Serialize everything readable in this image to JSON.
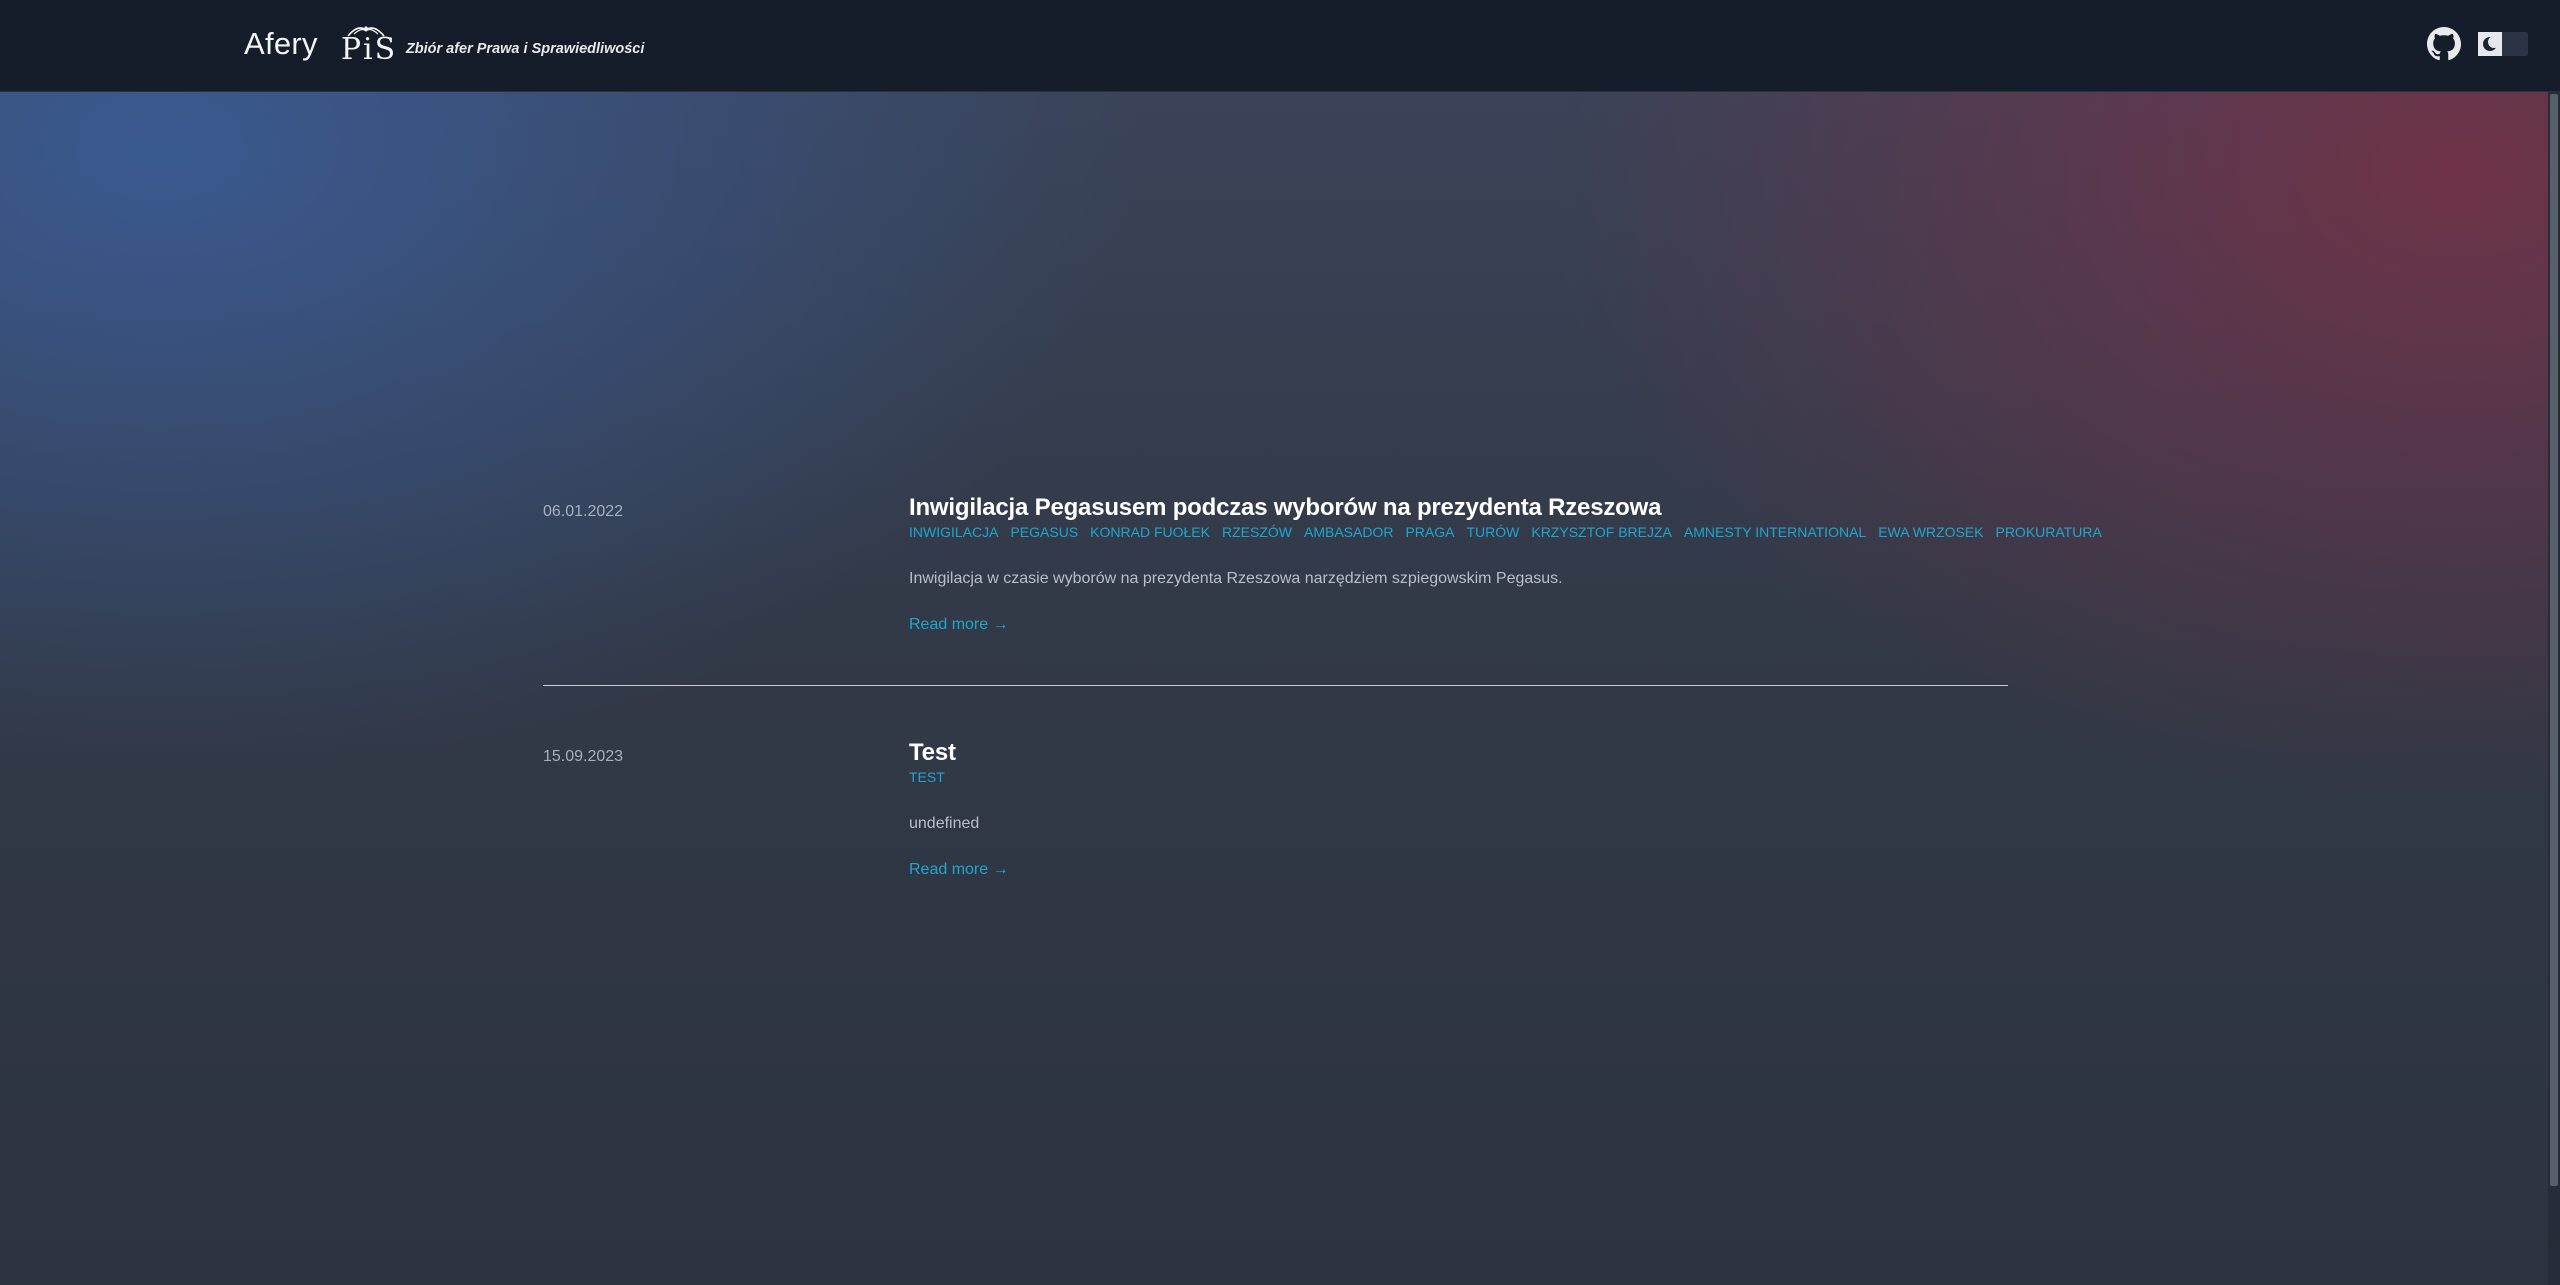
{
  "header": {
    "brand_title": "Afery",
    "logo_text": "PiS",
    "subtitle": "Zbiór afer Prawa i Sprawiedliwości",
    "github_icon": "github-icon",
    "theme_toggle_icon": "moon-icon"
  },
  "posts": [
    {
      "date": "06.01.2022",
      "title": "Inwigilacja Pegasusem podczas wyborów na prezydenta Rzeszowa",
      "tags": [
        "INWIGILACJA",
        "PEGASUS",
        "KONRAD FUOŁEK",
        "RZESZÓW",
        "AMBASADOR",
        "PRAGA",
        "TURÓW",
        "KRZYSZTOF BREJZA",
        "AMNESTY INTERNATIONAL",
        "EWA WRZOSEK",
        "PROKURATURA"
      ],
      "summary": "Inwigilacja w czasie wyborów na prezydenta Rzeszowa narzędziem szpiegowskim Pegasus.",
      "read_more": "Read more →"
    },
    {
      "date": "15.09.2023",
      "title": "Test",
      "tags": [
        "TEST"
      ],
      "summary": "undefined",
      "read_more": "Read more →"
    }
  ],
  "colors": {
    "header_bg": "#151d2a",
    "accent": "#1ea6cf",
    "gradient_left": "#3a5c96",
    "gradient_right": "#783046"
  }
}
